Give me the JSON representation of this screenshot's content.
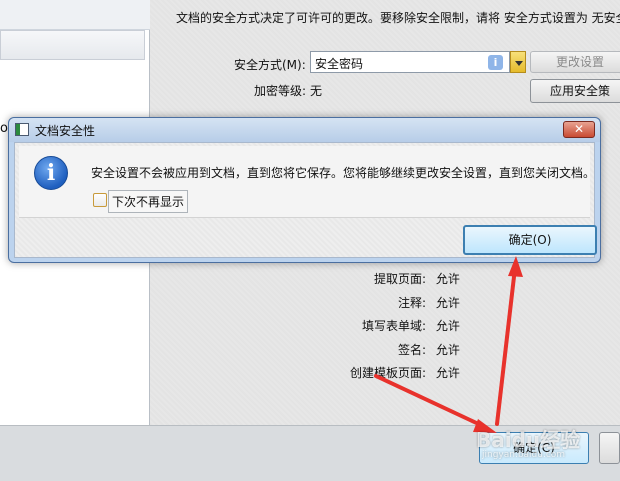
{
  "background": {
    "notice_text": "文档的安全方式决定了可许可的更改。要移除安全限制，请将 安全方式设置为 无安全",
    "security_method_label": "安全方式(M):",
    "security_method_value": "安全密码",
    "encryption_label": "加密等级:",
    "encryption_value": "无",
    "change_settings_button": "更改设置",
    "apply_security_button": "应用安全策",
    "left_fragment": "ot",
    "permissions": [
      {
        "label": "提取页面:",
        "value": "允许"
      },
      {
        "label": "注释:",
        "value": "允许"
      },
      {
        "label": "填写表单域:",
        "value": "允许"
      },
      {
        "label": "签名:",
        "value": "允许"
      },
      {
        "label": "创建模板页面:",
        "value": "允许"
      }
    ],
    "bottom_ok_button": "确定(C)"
  },
  "dialog": {
    "title": "文档安全性",
    "message": "安全设置不会被应用到文档，直到您将它保存。您将能够继续更改安全设置，直到您关闭文档。",
    "checkbox_label": "下次不再显示",
    "ok_button": "确定(O)",
    "close_symbol": "✕"
  },
  "icons": {
    "info": "i",
    "field_info": "i"
  },
  "watermark": {
    "text": "Baidu经验",
    "sub": "jingyan.baidu.com"
  },
  "colors": {
    "arrow": "#e8322c",
    "dialog_frame": "#bcd3ee",
    "ok_button_border": "#3c7fb1"
  }
}
